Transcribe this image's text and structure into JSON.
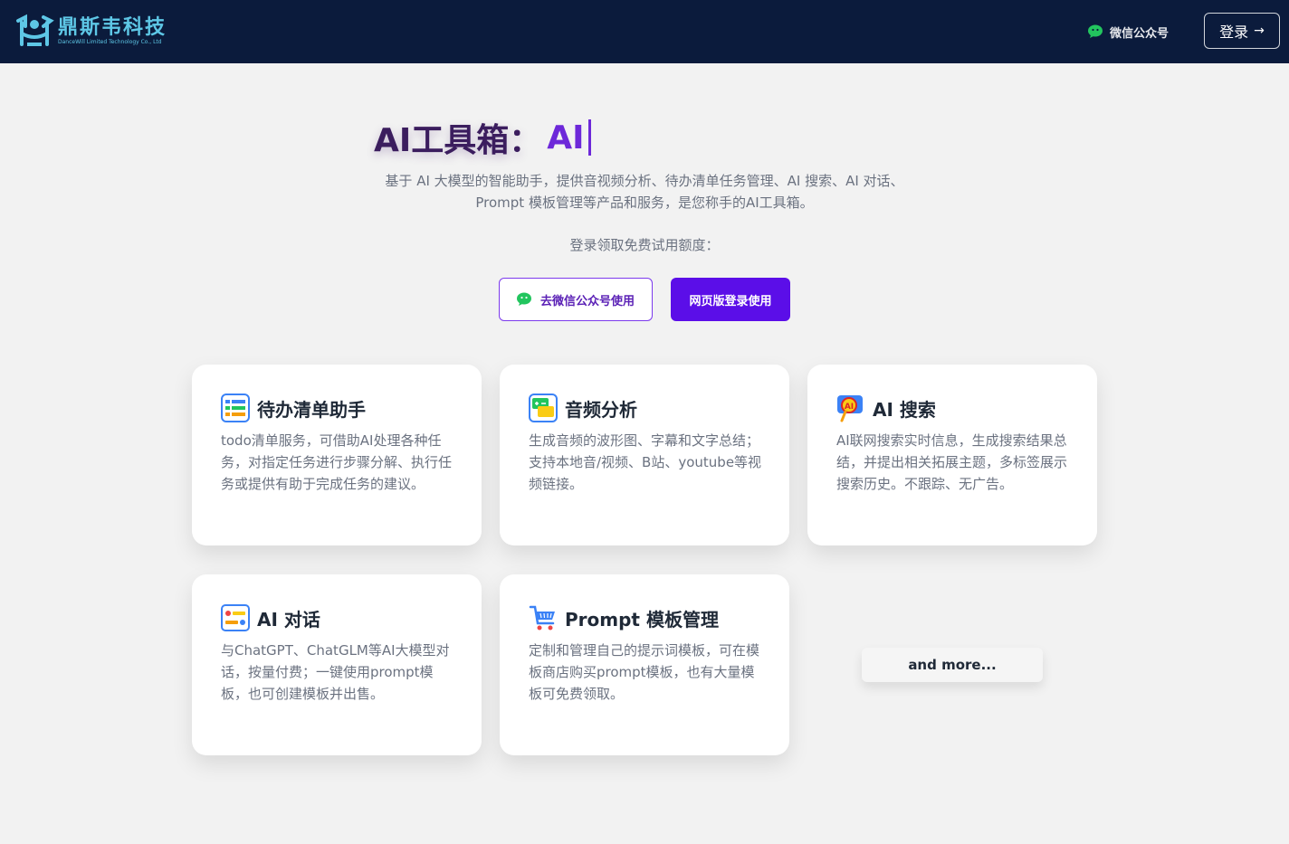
{
  "header": {
    "logo_cn": "鼎斯韦科技",
    "logo_en": "DanceWill Limited Technology Co., Ltd",
    "wechat_label": "微信公众号",
    "login_label": "登录",
    "login_arrow": "→"
  },
  "hero": {
    "title_static": "AI工具箱：",
    "title_typed": "AI",
    "description": "基于 AI 大模型的智能助手，提供音视频分析、待办清单任务管理、AI 搜索、AI 对话、Prompt 模板管理等产品和服务，是您称手的AI工具箱。",
    "subtitle": "登录领取免费试用额度：",
    "btn_wechat": "去微信公众号使用",
    "btn_web": "网页版登录使用"
  },
  "cards": [
    {
      "title": "待办清单助手",
      "desc": "todo清单服务，可借助AI处理各种任务，对指定任务进行步骤分解、执行任务或提供有助于完成任务的建议。",
      "icon": "checklist-icon"
    },
    {
      "title": "音频分析",
      "desc": "生成音频的波形图、字幕和文字总结；支持本地音/视频、B站、youtube等视频链接。",
      "icon": "audio-icon"
    },
    {
      "title": "AI 搜索",
      "desc": "AI联网搜索实时信息，生成搜索结果总结，并提出相关拓展主题，多标签展示搜索历史。不跟踪、无广告。",
      "icon": "ai-search-icon"
    },
    {
      "title": "AI 对话",
      "desc": "与ChatGPT、ChatGLM等AI大模型对话，按量付费；一键使用prompt模板，也可创建模板并出售。",
      "icon": "chat-icon"
    },
    {
      "title": "Prompt 模板管理",
      "desc": "定制和管理自己的提示词模板，可在模板商店购买prompt模板，也有大量模板可免费领取。",
      "icon": "cart-icon"
    }
  ],
  "more_label": "and more...",
  "colors": {
    "header_bg": "#0b1b3c",
    "accent": "#5b0ee8",
    "wechat_green": "#22c55e"
  }
}
